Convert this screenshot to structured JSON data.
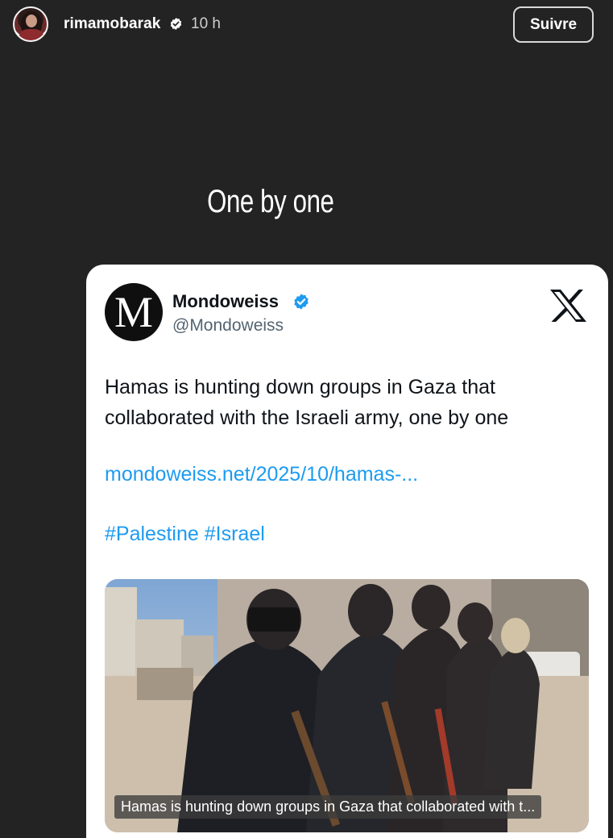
{
  "header": {
    "username": "rimamobarak",
    "time": "10 h",
    "follow_label": "Suivre"
  },
  "story": {
    "caption": "One by one"
  },
  "tweet": {
    "account_name": "Mondoweiss",
    "handle": "@Mondoweiss",
    "logo_letter": "M",
    "text": "Hamas is hunting down groups in Gaza that collaborated with the Israeli army, one by one",
    "link": "mondoweiss.net/2025/10/hamas-...",
    "hashtags": [
      "#Palestine",
      "#Israel"
    ],
    "media_caption": "Hamas is hunting down groups in Gaza that collaborated with t..."
  },
  "icons": {
    "verified_badge": "verified-badge-icon",
    "x_logo": "x-logo-icon"
  },
  "colors": {
    "background": "#232323",
    "link_blue": "#1d9bf0",
    "verified_blue": "#1d9bf0"
  }
}
